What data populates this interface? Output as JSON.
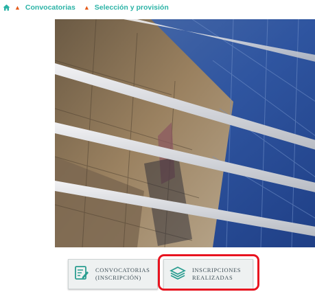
{
  "breadcrumb": {
    "home_icon": "home-icon",
    "items": [
      "Convocatorias",
      "Selección y provisión"
    ]
  },
  "hero": {
    "alt": "Fachada de edificio de cristal con reflejos"
  },
  "buttons": {
    "convocatorias": {
      "line1": "CONVOCATORIAS",
      "line2": "(INSCRIPCIÓN)",
      "icon": "edit-document-icon"
    },
    "inscripciones": {
      "line1": "INSCRIPCIONES",
      "line2": "REALIZADAS",
      "icon": "stack-layers-icon"
    }
  },
  "colors": {
    "breadcrumb_text": "#2bb3a6",
    "separator": "#e65b1a",
    "icon_teal": "#2a9d90",
    "highlight": "#e8131f"
  }
}
